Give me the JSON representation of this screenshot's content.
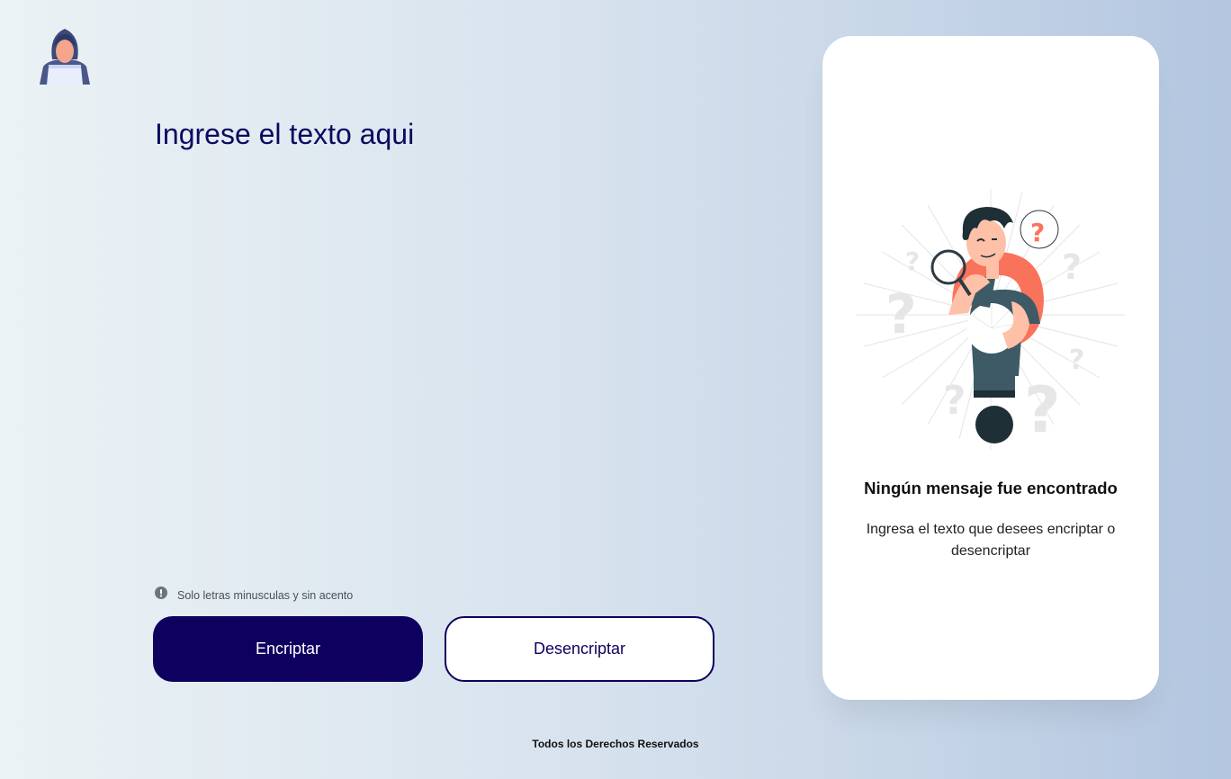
{
  "header": {
    "logo_icon": "hooded-hacker-icon"
  },
  "editor": {
    "placeholder": "Ingrese el texto aqui",
    "value": ""
  },
  "hint": {
    "icon": "exclamation-circle-icon",
    "text": "Solo letras minusculas y sin acento"
  },
  "buttons": {
    "encrypt_label": "Encriptar",
    "decrypt_label": "Desencriptar"
  },
  "output": {
    "illustration_icon": "confused-person-question-icon",
    "title": "Ningún mensaje fue encontrado",
    "description": "Ingresa el texto que desees encriptar o desencriptar"
  },
  "footer": {
    "text": "Todos los Derechos Reservados"
  },
  "colors": {
    "primary": "#0e005f",
    "accent": "#f9735b",
    "card_bg": "#ffffff",
    "text": "#0a0a5f"
  }
}
